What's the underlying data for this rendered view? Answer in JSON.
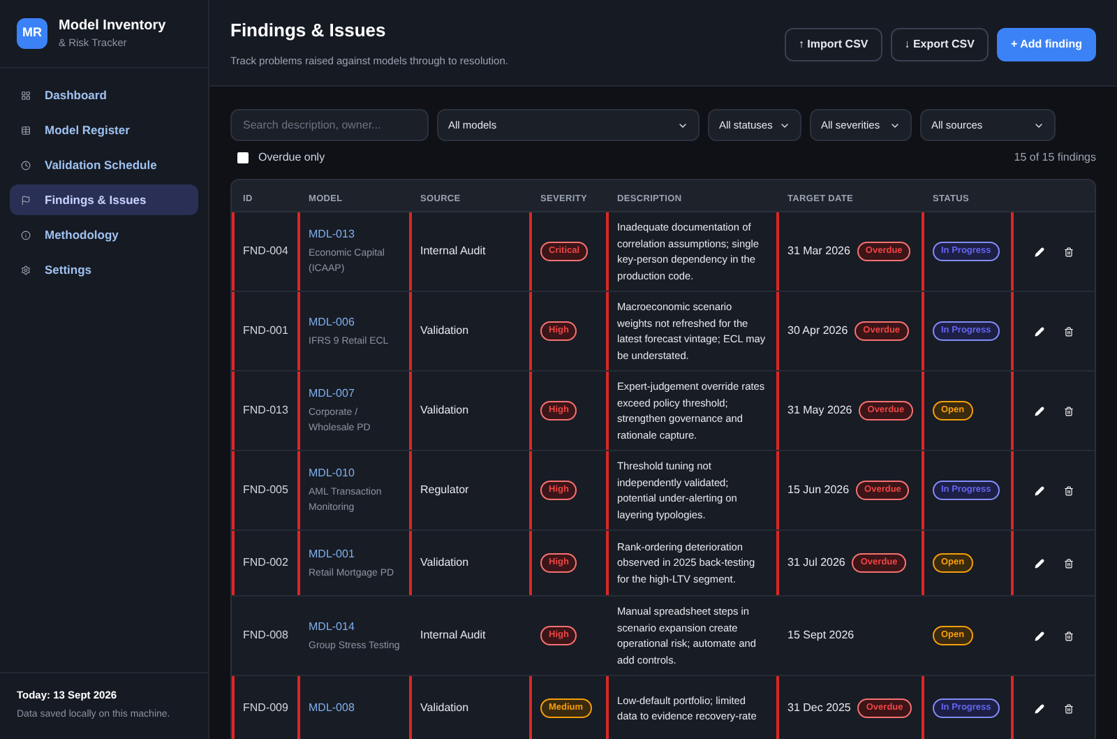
{
  "brand": {
    "logo": "MR",
    "title": "Model Inventory",
    "subtitle": "& Risk Tracker"
  },
  "nav": [
    {
      "label": "Dashboard",
      "selected": false
    },
    {
      "label": "Model Register",
      "selected": false
    },
    {
      "label": "Validation Schedule",
      "selected": false
    },
    {
      "label": "Findings & Issues",
      "selected": true
    },
    {
      "label": "Methodology",
      "selected": false
    },
    {
      "label": "Settings",
      "selected": false
    }
  ],
  "sidebar_footer": {
    "today": "Today: 13 Sept 2026",
    "note": "Data saved locally on this machine."
  },
  "header": {
    "title": "Findings & Issues",
    "subtitle": "Track problems raised against models through to resolution.",
    "buttons": [
      {
        "label": "↑ Import CSV",
        "kind": "outline"
      },
      {
        "label": "↓ Export CSV",
        "kind": "outline"
      },
      {
        "label": "+ Add finding",
        "kind": "primary"
      }
    ]
  },
  "filters": {
    "search": {
      "placeholder": "Search description, owner..."
    },
    "selects": [
      "All models",
      "All statuses",
      "All severities",
      "All sources"
    ],
    "overdue_only": {
      "label": "Overdue only",
      "checked": false
    },
    "count": "15 of 15 findings"
  },
  "table": {
    "columns": [
      "ID",
      "MODEL",
      "SOURCE",
      "SEVERITY",
      "DESCRIPTION",
      "TARGET DATE",
      "STATUS"
    ],
    "rows": [
      {
        "id": "FND-004",
        "model_id": "MDL-013",
        "model_name": "Economic Capital (ICAAP)",
        "source": "Internal Audit",
        "severity": {
          "label": "Critical",
          "kind": "critical"
        },
        "description": "Inadequate documentation of correlation assumptions; single key-person dependency in the production code.",
        "target_date": "31 Mar 2026",
        "overdue": true,
        "overdue_label": "Overdue",
        "status": {
          "label": "In Progress",
          "kind": "in_progress"
        }
      },
      {
        "id": "FND-001",
        "model_id": "MDL-006",
        "model_name": "IFRS 9 Retail ECL",
        "source": "Validation",
        "severity": {
          "label": "High",
          "kind": "high"
        },
        "description": "Macroeconomic scenario weights not refreshed for the latest forecast vintage; ECL may be understated.",
        "target_date": "30 Apr 2026",
        "overdue": true,
        "overdue_label": "Overdue",
        "status": {
          "label": "In Progress",
          "kind": "in_progress"
        }
      },
      {
        "id": "FND-013",
        "model_id": "MDL-007",
        "model_name": "Corporate / Wholesale PD",
        "source": "Validation",
        "severity": {
          "label": "High",
          "kind": "high"
        },
        "description": "Expert-judgement override rates exceed policy threshold; strengthen governance and rationale capture.",
        "target_date": "31 May 2026",
        "overdue": true,
        "overdue_label": "Overdue",
        "status": {
          "label": "Open",
          "kind": "open"
        }
      },
      {
        "id": "FND-005",
        "model_id": "MDL-010",
        "model_name": "AML Transaction Monitoring",
        "source": "Regulator",
        "severity": {
          "label": "High",
          "kind": "high"
        },
        "description": "Threshold tuning not independently validated; potential under-alerting on layering typologies.",
        "target_date": "15 Jun 2026",
        "overdue": true,
        "overdue_label": "Overdue",
        "status": {
          "label": "In Progress",
          "kind": "in_progress"
        }
      },
      {
        "id": "FND-002",
        "model_id": "MDL-001",
        "model_name": "Retail Mortgage PD",
        "source": "Validation",
        "severity": {
          "label": "High",
          "kind": "high"
        },
        "description": "Rank-ordering deterioration observed in 2025 back-testing for the high-LTV segment.",
        "target_date": "31 Jul 2026",
        "overdue": true,
        "overdue_label": "Overdue",
        "status": {
          "label": "Open",
          "kind": "open"
        }
      },
      {
        "id": "FND-008",
        "model_id": "MDL-014",
        "model_name": "Group Stress Testing",
        "source": "Internal Audit",
        "severity": {
          "label": "High",
          "kind": "high"
        },
        "description": "Manual spreadsheet steps in scenario expansion create operational risk; automate and add controls.",
        "target_date": "15 Sept 2026",
        "overdue": false,
        "status": {
          "label": "Open",
          "kind": "open"
        }
      },
      {
        "id": "FND-009",
        "model_id": "MDL-008",
        "source": "Validation",
        "severity": {
          "label": "Medium",
          "kind": "medium"
        },
        "description": "Low-default portfolio; limited data to evidence recovery-rate",
        "target_date": "31 Dec 2025",
        "overdue": true,
        "overdue_label": "Overdue",
        "status": {
          "label": "In Progress",
          "kind": "in_progress"
        }
      }
    ]
  }
}
